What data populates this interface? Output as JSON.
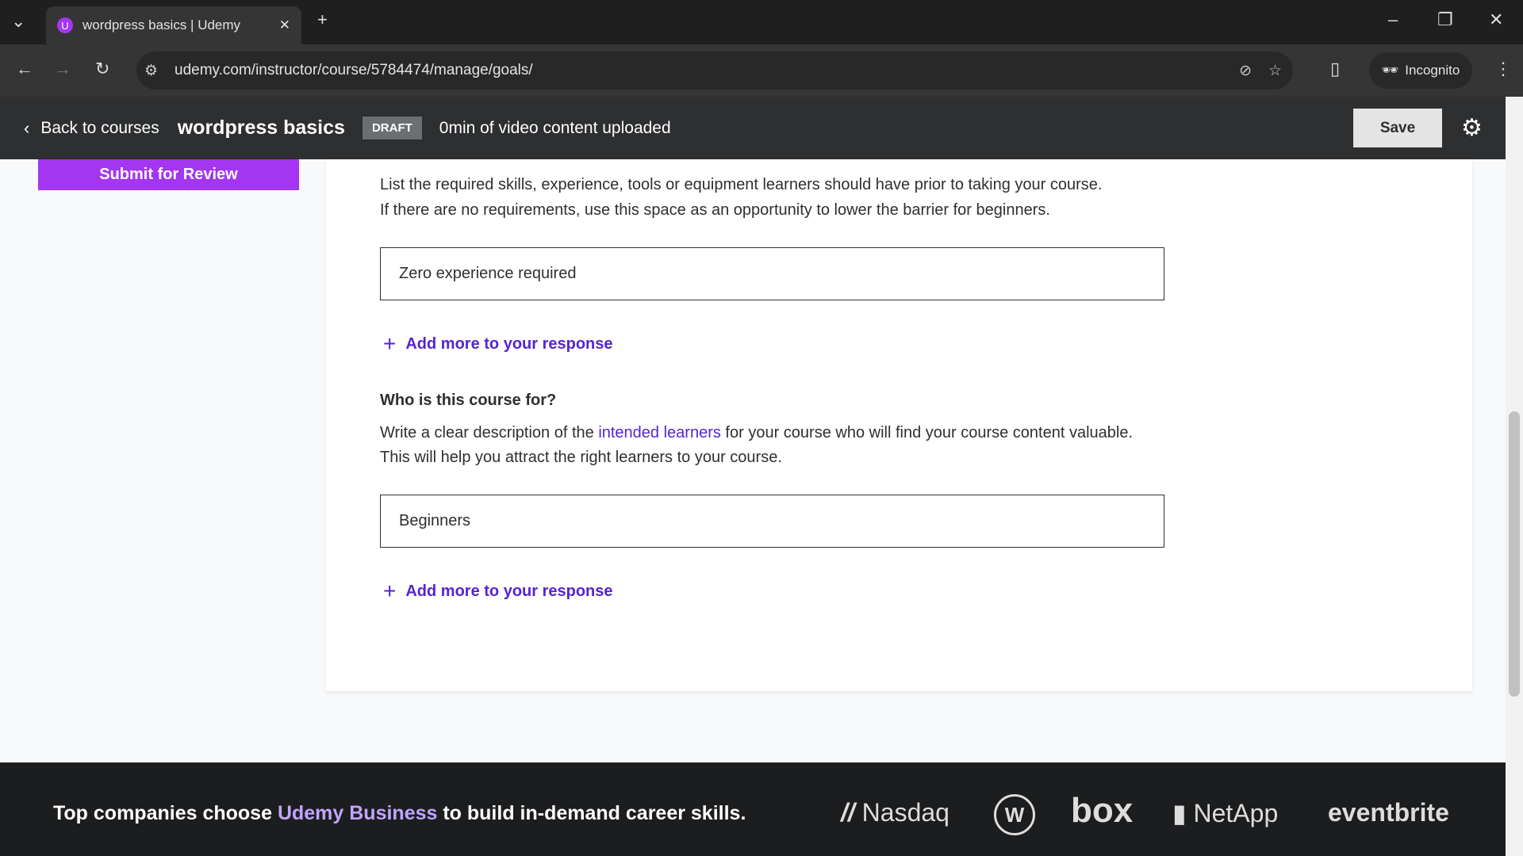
{
  "browser": {
    "tab_title": "wordpress basics | Udemy",
    "url": "udemy.com/instructor/course/5784474/manage/goals/",
    "incognito": "Incognito"
  },
  "header": {
    "back": "Back to courses",
    "course_title": "wordpress basics",
    "status": "DRAFT",
    "video_info": "0min of video content uploaded",
    "save": "Save"
  },
  "sidebar": {
    "submit": "Submit for Review"
  },
  "requirements": {
    "line1": "List the required skills, experience, tools or equipment learners should have prior to taking your course.",
    "line2": "If there are no requirements, use this space as an opportunity to lower the barrier for beginners.",
    "value": "Zero experience required",
    "add": "Add more to your response"
  },
  "audience": {
    "heading": "Who is this course for?",
    "pre": "Write a clear description of the ",
    "link": "intended learners",
    "post": " for your course who will find your course content valuable.",
    "line2": "This will help you attract the right learners to your course.",
    "value": "Beginners",
    "add": "Add more to your response"
  },
  "footer": {
    "pre": "Top companies choose ",
    "link": "Udemy Business",
    "post": " to build in-demand career skills.",
    "logos": [
      "Nasdaq",
      "VW",
      "box",
      "NetApp",
      "eventbrite"
    ]
  },
  "colors": {
    "accent": "#a435f0",
    "link": "#5624d0",
    "dark": "#2d2f31"
  }
}
